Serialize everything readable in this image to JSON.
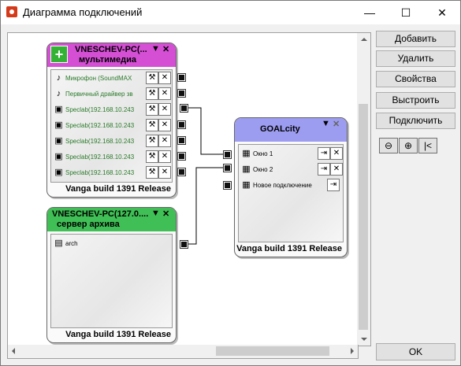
{
  "window": {
    "title": "Диаграмма подключений"
  },
  "title_buttons": {
    "minimize": "—",
    "maximize": "☐",
    "close": "✕"
  },
  "node_multimedia": {
    "name": "VNESCHEV-PC(...",
    "subtitle": "мультимедиа",
    "footer": "Vanga build  1391 Release",
    "header_color": "#d44fd4",
    "rows": [
      {
        "icon": "note-icon",
        "label": "Микрофон (SoundMAX"
      },
      {
        "icon": "note-icon",
        "label": "Первичный драйвер зв"
      },
      {
        "icon": "camera-icon",
        "label": "Speclab(192.168.10.243"
      },
      {
        "icon": "camera-icon",
        "label": "Speclab(192.168.10.243"
      },
      {
        "icon": "camera-icon",
        "label": "Speclab(192.168.10.243"
      },
      {
        "icon": "camera-icon",
        "label": "Speclab(192.168.10.243"
      },
      {
        "icon": "camera-icon",
        "label": "Speclab(192.168.10.243"
      }
    ]
  },
  "node_archive": {
    "name": "VNESCHEV-PC(127.0....",
    "subtitle": "сервер архива",
    "footer": "Vanga build  1391 Release",
    "header_color": "#3fbf55",
    "rows": [
      {
        "icon": "archive-icon",
        "label": "arch"
      }
    ]
  },
  "node_goal": {
    "name": "GOALcity",
    "footer": "Vanga build  1391 Release",
    "header_color": "#9c9cf0",
    "rows": [
      {
        "icon": "window-icon",
        "label": "Окно 1"
      },
      {
        "icon": "window-icon",
        "label": "Окно 2"
      },
      {
        "icon": "window-icon",
        "label": "Новое подключение"
      }
    ]
  },
  "sidebar": {
    "add": "Добавить",
    "remove": "Удалить",
    "properties": "Свойства",
    "arrange": "Выстроить",
    "connect": "Подключить",
    "ok": "OK"
  },
  "zoom": {
    "out": "⊖",
    "in": "⊕",
    "fit": "|<"
  }
}
